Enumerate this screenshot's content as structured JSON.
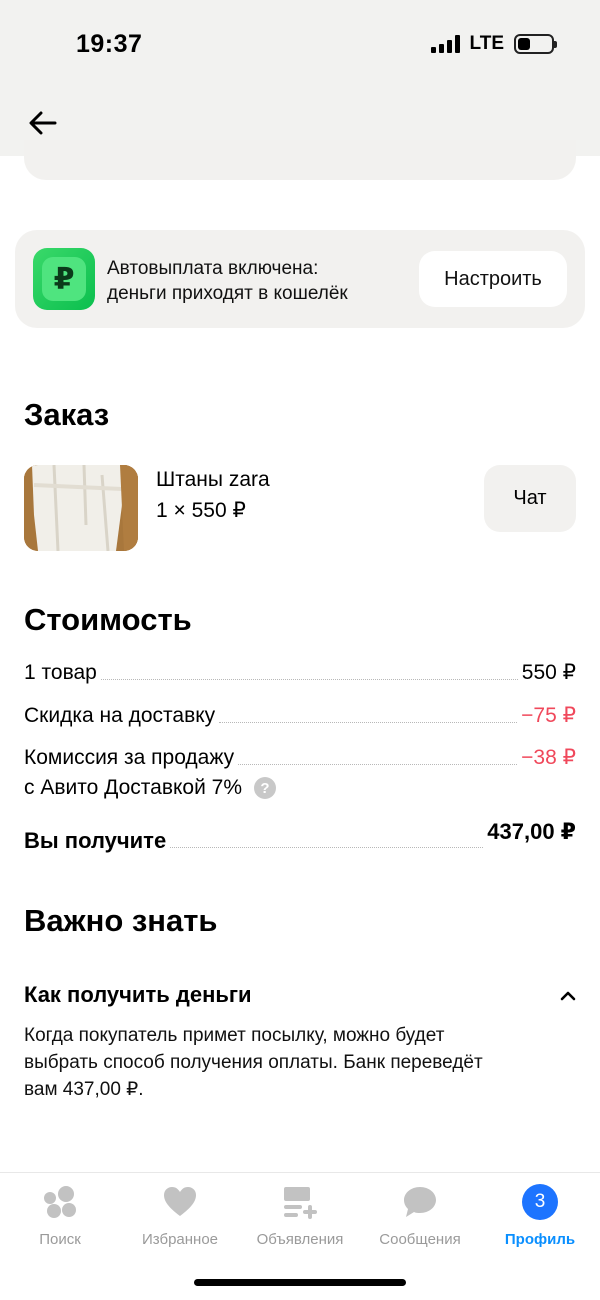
{
  "status_bar": {
    "time": "19:37",
    "network": "LTE"
  },
  "autopay": {
    "icon": "ruble-wallet-icon",
    "icon_glyph": "₽",
    "line1": "Автовыплата включена:",
    "line2": "деньги приходят в кошелёк",
    "button_label": "Настроить",
    "accent_color": "#22d060"
  },
  "order": {
    "title": "Заказ",
    "product_name": "Штаны zara",
    "product_qty": "1 × 550 ₽",
    "chat_label": "Чат"
  },
  "cost": {
    "title": "Стоимость",
    "rows": [
      {
        "label": "1 товар",
        "value": "550 ₽"
      },
      {
        "label": "Скидка на доставку",
        "value": "−75 ₽"
      },
      {
        "label": "Комиссия за продажу",
        "value": "−38 ₽"
      }
    ],
    "commission_sub": "с Авито Доставкой 7%",
    "help_glyph": "?",
    "total_label": "Вы получите",
    "total_value": "437,00 ₽",
    "negative_color": "#f0485b"
  },
  "info": {
    "title": "Важно знать",
    "accordion_title": "Как получить деньги",
    "accordion_expanded": true,
    "accordion_line1": "Когда покупатель примет посылку, можно будет",
    "accordion_line2": "выбрать способ получения оплаты. Банк переведёт",
    "accordion_line3": "вам 437,00 ₽."
  },
  "tabs": [
    {
      "label": "Поиск",
      "icon": "search-dots-icon",
      "active": false
    },
    {
      "label": "Избранное",
      "icon": "heart-icon",
      "active": false
    },
    {
      "label": "Объявления",
      "icon": "listings-add-icon",
      "active": false
    },
    {
      "label": "Сообщения",
      "icon": "chat-bubble-icon",
      "active": false
    },
    {
      "label": "Профиль",
      "icon": "profile-badge-icon",
      "badge": "3",
      "active": true
    }
  ]
}
